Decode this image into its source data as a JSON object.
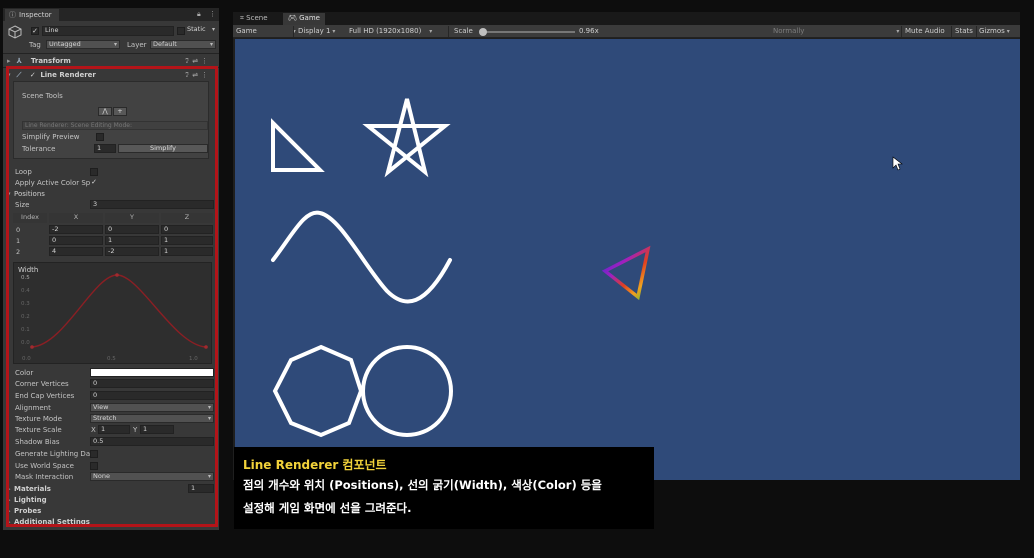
{
  "inspector": {
    "tab_label": "Inspector",
    "object_name": "Line",
    "static_label": "Static",
    "tag_label": "Tag",
    "tag_value": "Untagged",
    "layer_label": "Layer",
    "layer_value": "Default",
    "transform_label": "Transform",
    "line_renderer": {
      "title": "Line Renderer",
      "scene_tools_label": "Scene Tools",
      "edit_mode_placeholder": "Line Renderer: Scene Editing Mode:",
      "simplify_preview_label": "Simplify Preview",
      "tolerance_label": "Tolerance",
      "tolerance_value": "1",
      "simplify_button": "Simplify",
      "loop_label": "Loop",
      "apply_active_color_label": "Apply Active Color Sp",
      "positions_label": "Positions",
      "size_label": "Size",
      "size_value": "3",
      "columns": [
        "Index",
        "X",
        "Y",
        "Z"
      ],
      "rows": [
        [
          "0",
          "-2",
          "0",
          "0"
        ],
        [
          "1",
          "0",
          "1",
          "1"
        ],
        [
          "2",
          "4",
          "-2",
          "1"
        ]
      ],
      "width_label": "Width",
      "width_y_ticks": [
        "0.5",
        "0.4",
        "0.3",
        "0.2",
        "0.1",
        "0.0"
      ],
      "width_x_ticks": [
        "0.0",
        "0.5",
        "1.0"
      ],
      "color_label": "Color",
      "color_value": "#ffffff",
      "corner_vertices_label": "Corner Vertices",
      "corner_vertices_value": "0",
      "end_cap_vertices_label": "End Cap Vertices",
      "end_cap_vertices_value": "0",
      "alignment_label": "Alignment",
      "alignment_value": "View",
      "texture_mode_label": "Texture Mode",
      "texture_mode_value": "Stretch",
      "texture_scale_label": "Texture Scale",
      "texture_scale_x_label": "X",
      "texture_scale_x": "1",
      "texture_scale_y_label": "Y",
      "texture_scale_y": "1",
      "shadow_bias_label": "Shadow Bias",
      "shadow_bias_value": "0.5",
      "generate_lighting_label": "Generate Lighting Da",
      "use_world_space_label": "Use World Space",
      "mask_interaction_label": "Mask Interaction",
      "mask_interaction_value": "None",
      "materials_label": "Materials",
      "materials_count": "1",
      "lighting_label": "Lighting",
      "probes_label": "Probes",
      "additional_settings_label": "Additional Settings"
    }
  },
  "gameview": {
    "tabs": [
      "Scene",
      "Game"
    ],
    "toolbar": {
      "mode": "Game",
      "display": "Display 1",
      "resolution": "Full HD (1920x1080)",
      "scale_label": "Scale",
      "scale_value": "0.96x",
      "normally": "Normally",
      "mute_audio": "Mute Audio",
      "stats": "Stats",
      "gizmos": "Gizmos"
    },
    "background_color": "#2f4a79"
  },
  "caption": {
    "title_en": "Line Renderer",
    "title_ko": " 컴포넌트",
    "line1": "점의 개수와 위치 (Positions), 선의 굵기(Width), 색상(Color) 등을",
    "line2": "설정해 게임 화면에 선을 그려준다."
  }
}
